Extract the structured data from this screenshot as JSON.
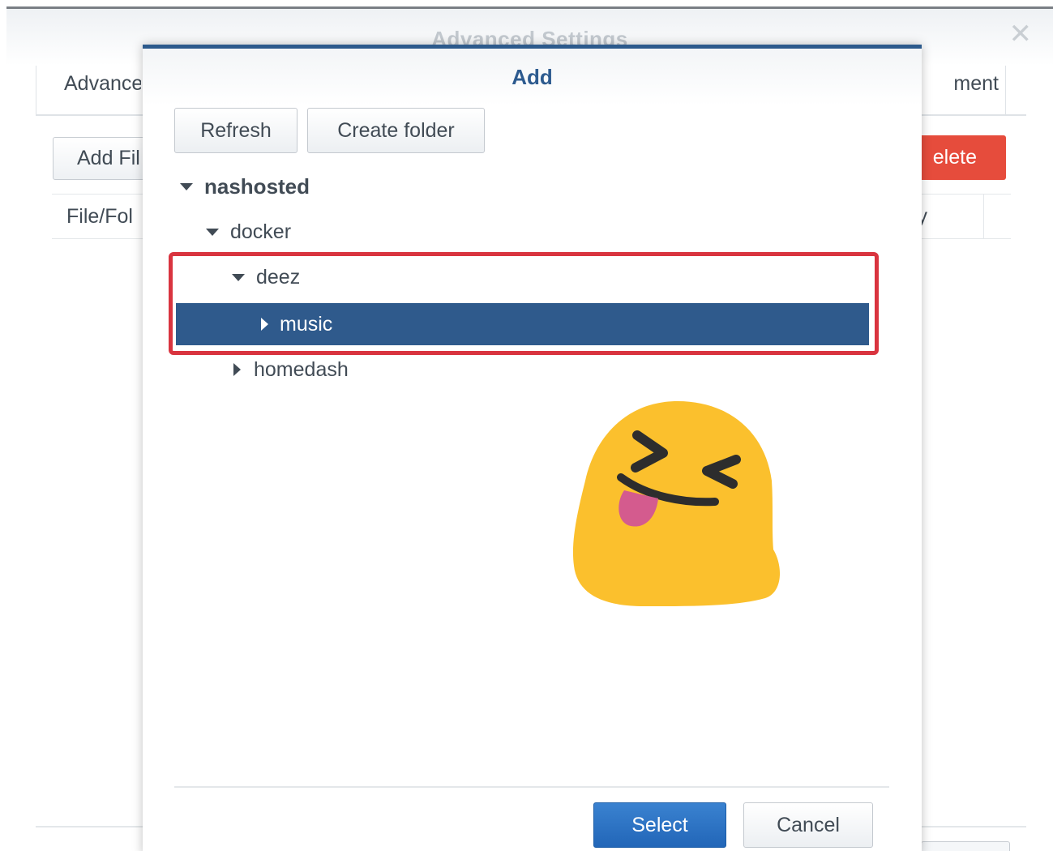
{
  "background_window": {
    "title": "Advanced Settings",
    "close_icon": "close-icon",
    "tab_left_label": "Advance",
    "tab_right_label": "ment",
    "add_button_label": "Add Fil",
    "delete_button_label": "elete",
    "column_left_label": "File/Fol",
    "column_right_label": "ly"
  },
  "dialog": {
    "title": "Add",
    "toolbar": {
      "refresh_label": "Refresh",
      "create_folder_label": "Create folder"
    },
    "tree": {
      "root": "nashosted",
      "level1": "docker",
      "level2": "deez",
      "selected": "music",
      "sibling": "homedash"
    },
    "footer": {
      "select_label": "Select",
      "cancel_label": "Cancel"
    }
  },
  "colors": {
    "accent": "#2f5a8c",
    "primary_button": "#2266b8",
    "danger": "#e64c3c",
    "highlight_box": "#d9343f",
    "emoji_face": "#fbc02d",
    "emoji_tongue": "#d45b8e"
  },
  "overlay": {
    "emoji_icon": "squinting-face-with-tongue-emoji"
  }
}
